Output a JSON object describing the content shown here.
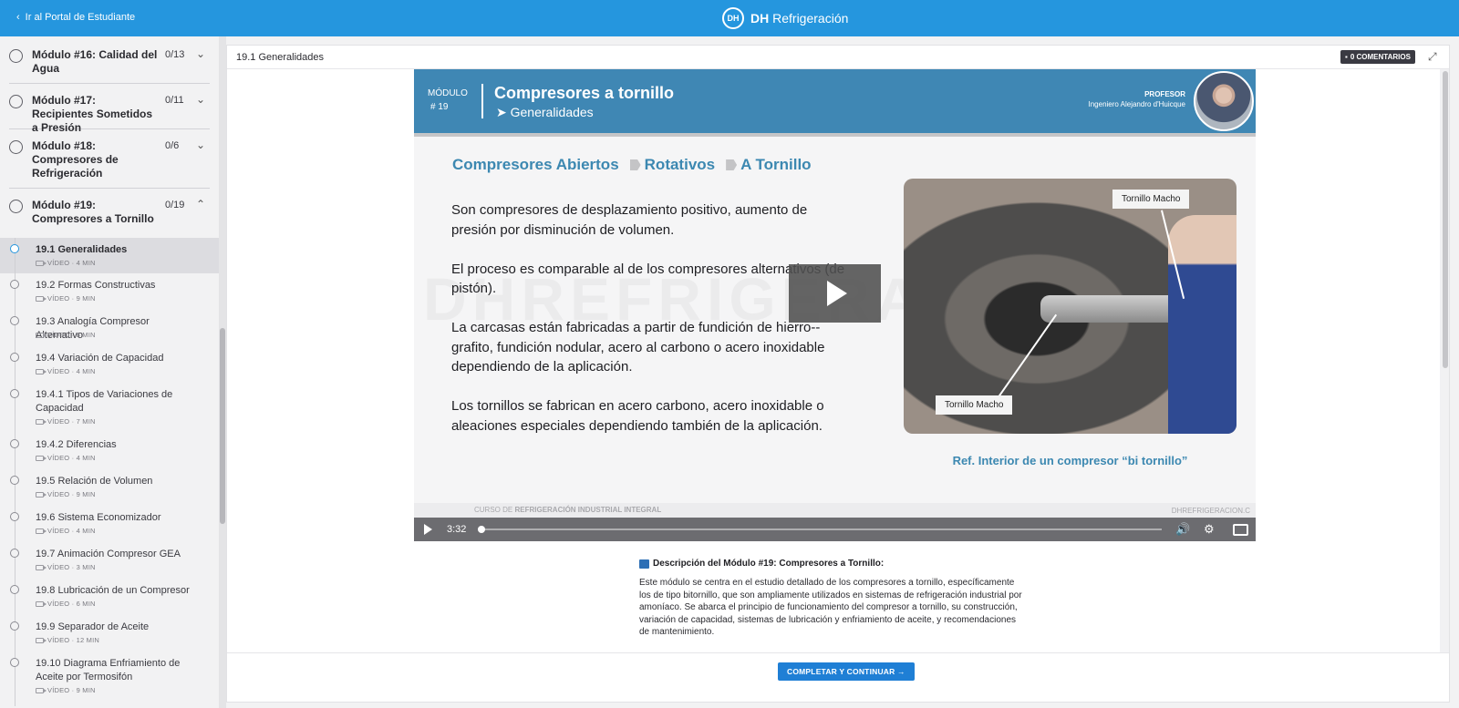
{
  "topbar": {
    "back_label": "Ir al Portal de Estudiante",
    "logo_text": "DH",
    "brand_bold": "DH",
    "brand_name": "Refrigeración",
    "bg_color": "#2596de"
  },
  "sidebar": {
    "modules": [
      {
        "title": "Módulo #16: Calidad del Agua",
        "count": "0/13",
        "expanded": false
      },
      {
        "title": "Módulo #17: Recipientes Sometidos a Presión",
        "count": "0/11",
        "expanded": false
      },
      {
        "title": "Módulo #18: Compresores de Refrigeración",
        "count": "0/6",
        "expanded": false
      },
      {
        "title": "Módulo #19: Compresores a Tornillo",
        "count": "0/19",
        "expanded": true
      }
    ],
    "lessons": [
      {
        "title": "19.1 Generalidades",
        "meta": "VÍDEO · 4 MIN",
        "active": true
      },
      {
        "title": "19.2 Formas Constructivas",
        "meta": "VÍDEO · 9 MIN"
      },
      {
        "title": "19.3 Analogía Compresor Alternativo",
        "meta": "VÍDEO · 5 MIN"
      },
      {
        "title": "19.4 Variación de Capacidad",
        "meta": "VÍDEO · 4 MIN"
      },
      {
        "title": "19.4.1 Tipos de Variaciones de Capacidad",
        "meta": "VÍDEO · 7 MIN"
      },
      {
        "title": "19.4.2 Diferencias",
        "meta": "VÍDEO · 4 MIN"
      },
      {
        "title": "19.5 Relación de Volumen",
        "meta": "VÍDEO · 9 MIN"
      },
      {
        "title": "19.6 Sistema Economizador",
        "meta": "VÍDEO · 4 MIN"
      },
      {
        "title": "19.7 Animación Compresor GEA",
        "meta": "VÍDEO · 3 MIN"
      },
      {
        "title": "19.8 Lubricación de un Compresor",
        "meta": "VÍDEO · 6 MIN"
      },
      {
        "title": "19.9 Separador de Aceite",
        "meta": "VÍDEO · 12 MIN"
      },
      {
        "title": "19.10 Diagrama Enfriamiento de Aceite por Termosifón",
        "meta": "VÍDEO · 9 MIN"
      }
    ]
  },
  "main": {
    "lesson_title": "19.1 Generalidades",
    "comments_label": "0 COMENTARIOS",
    "complete_label": "COMPLETAR Y CONTINUAR →"
  },
  "video": {
    "module_label": "MÓDULO",
    "module_number": "# 19",
    "title": "Compresores a tornillo",
    "subtitle": "Generalidades",
    "professor_label": "PROFESOR",
    "professor_name": "Ingeniero Alejandro d'Huicque",
    "crumbs": [
      "Compresores Abiertos",
      "Rotativos",
      "A Tornillo"
    ],
    "paragraphs": [
      "Son compresores de desplazamiento positivo, aumento de presión por disminución de volumen.",
      "El proceso es comparable al de los compresores alternativos (de pistón).",
      "La carcasas están fabricadas a partir de fundición de hierro--grafito, fundición nodular, acero al carbono o acero inoxidable dependiendo de la aplicación.",
      "Los tornillos se fabrican en acero carbono, acero inoxidable o aleaciones especiales dependiendo también de la aplicación."
    ],
    "photo_label_1": "Tornillo Macho",
    "photo_label_2": "Tornillo Macho",
    "caption": "Ref. Interior de un compresor “bi tornillo”",
    "watermark": "DHREFRIGERACION",
    "footer_prefix": "CURSO DE",
    "footer_course": "REFRIGERACIÓN INDUSTRIAL INTEGRAL",
    "footer_site": "DHREFRIGERACION.C",
    "current_time": "3:32",
    "progress_fraction": 0.005
  },
  "description": {
    "title": "Descripción del Módulo #19: Compresores a Tornillo:",
    "body": "Este módulo se centra en el estudio detallado de los compresores a tornillo, específicamente los de tipo bitornillo, que son ampliamente utilizados en sistemas de refrigeración industrial por amoníaco. Se abarca el principio de funcionamiento del compresor a tornillo, su construcción, variación de capacidad, sistemas de lubricación y enfriamiento de aceite, y recomendaciones de mantenimiento."
  }
}
